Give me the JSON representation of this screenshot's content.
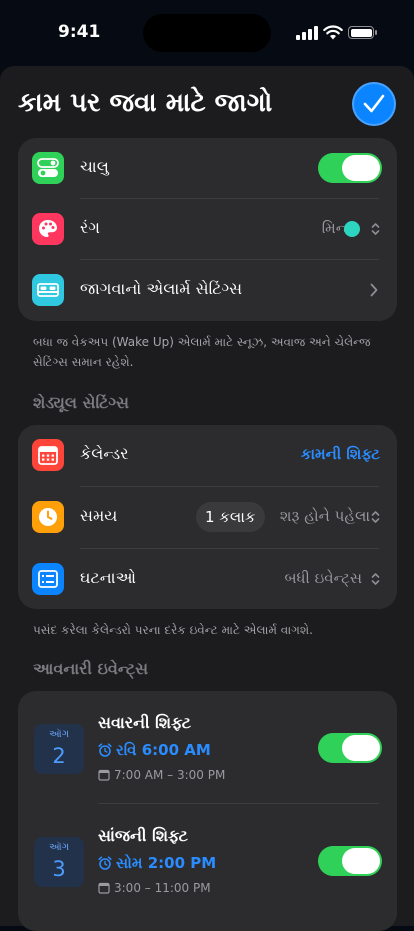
{
  "status": {
    "time": "9:41"
  },
  "header": {
    "title": "કામ પર જવા માટે જાગો"
  },
  "main_settings": {
    "enabled_label": "ચાલુ",
    "enabled_on": true,
    "color_label": "રંગ",
    "color_value": "મિન્ટ",
    "color_swatch": "#2dd4bf",
    "wake_label": "જાગવાનો એલાર્મ સેટિંગ્સ",
    "footer": "બધા જ વેકઅપ (Wake Up) એલાર્મ માટે સ્નૂઝ, અવાજ અને ચેલેન્જ સેટિંગ્સ સમાન રહેશે."
  },
  "schedule": {
    "section_title": "શેડ્યૂલ સેટિંગ્સ",
    "calendar_label": "કેલેન્ડર",
    "calendar_value": "કામની શિફ્ટ",
    "time_label": "સમય",
    "time_amount": "1 કલાક",
    "time_suffix": "શરૂ હોને પહેલા",
    "events_label": "ઘટનાઓ",
    "events_value": "બધી ઇવેન્ટ્સ",
    "footer": "પસંદ કરેલા કેલેન્ડરો પરના દરેક ઇવેન્ટ માટે એલાર્મ વાગશે."
  },
  "upcoming": {
    "section_title": "આવનારી ઇવેન્ટ્સ",
    "events": [
      {
        "month": "ઑગ",
        "day": "2",
        "title": "સવારની શિફ્ટ",
        "alarm": "રવિ 6:00 AM",
        "range": "7:00 AM – 3:00 PM",
        "on": true
      },
      {
        "month": "ઑગ",
        "day": "3",
        "title": "સાંજની શિફ્ટ",
        "alarm": "સોમ 2:00 PM",
        "range": "3:00 – 11:00 PM",
        "on": true
      }
    ]
  },
  "colors": {
    "accent": "#0a84ff",
    "toggle_on": "#30d158",
    "card": "#2c2c2e",
    "sheet": "#1c1c1e"
  },
  "icons": [
    "toggle-icon",
    "palette-icon",
    "bed-icon",
    "calendar-icon",
    "clock-icon",
    "list-icon",
    "alarm-icon",
    "calendar-small-icon",
    "checkmark-icon",
    "chevron-right-icon",
    "chevron-updown-icon"
  ]
}
